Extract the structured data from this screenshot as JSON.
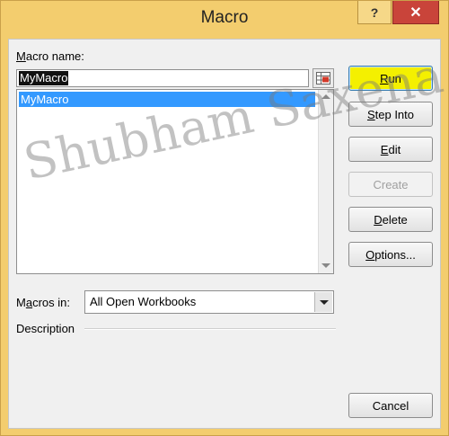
{
  "window": {
    "title": "Macro",
    "help_glyph": "?",
    "close_glyph": "✕"
  },
  "macro_name": {
    "label_prefix": "",
    "label_hotkey": "M",
    "label_rest": "acro name:",
    "value": "MyMacro"
  },
  "macro_list": {
    "items": [
      "MyMacro"
    ]
  },
  "macros_in": {
    "label_prefix": "M",
    "label_hotkey": "a",
    "label_rest": "cros in:",
    "selected": "All Open Workbooks"
  },
  "description": {
    "label": "Description"
  },
  "buttons": {
    "run": {
      "hotkey": "R",
      "rest": "un"
    },
    "step_into": {
      "hotkey": "S",
      "rest": "tep Into"
    },
    "edit": {
      "hotkey": "E",
      "rest": "dit"
    },
    "create": {
      "label": "Create"
    },
    "delete": {
      "hotkey": "D",
      "rest": "elete"
    },
    "options": {
      "hotkey": "O",
      "rest": "ptions..."
    },
    "cancel": {
      "label": "Cancel"
    }
  },
  "watermark": {
    "text": "Shubham Saxena"
  },
  "colors": {
    "frame": "#f3cd6e",
    "selection": "#3399ff",
    "run_button": "#f4f000",
    "close_button": "#c9443a"
  }
}
